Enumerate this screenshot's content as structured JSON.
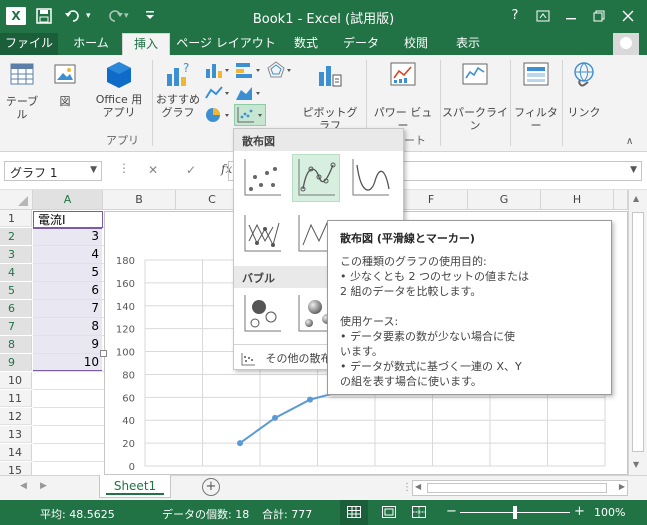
{
  "titlebar": {
    "app_icon": "X",
    "title": "Book1 - Excel (試用版)",
    "help": "?",
    "colors": {
      "bar": "#217346"
    }
  },
  "tabs": [
    {
      "label": "ファイル"
    },
    {
      "label": "ホーム"
    },
    {
      "label": "挿入"
    },
    {
      "label": "ページ レイアウト"
    },
    {
      "label": "数式"
    },
    {
      "label": "データ"
    },
    {
      "label": "校閲"
    },
    {
      "label": "表示"
    }
  ],
  "ribbon": {
    "table": "テーブル",
    "picture": "図",
    "office_apps": [
      "Office 用",
      "アプリ"
    ],
    "recommended_charts": [
      "おすすめ",
      "グラフ"
    ],
    "pivot_chart": "ピボットグラフ",
    "power_view": "パワー ビュー",
    "sparkline": "スパークライン",
    "filter": "フィルター",
    "link": "リンク",
    "group_apps": "アプリ",
    "group_chart_tail": "ート"
  },
  "formula_bar": {
    "name_box": "グラフ 1",
    "cancel": "✕",
    "enter": "✓",
    "fx": "fx"
  },
  "grid": {
    "columns": [
      "A",
      "B",
      "C",
      "D",
      "E",
      "F",
      "G",
      "H"
    ],
    "rows": [
      "1",
      "2",
      "3",
      "4",
      "5",
      "6",
      "7",
      "8",
      "9",
      "10",
      "11",
      "12",
      "13",
      "14",
      "15"
    ],
    "cells": {
      "A1": "電流I",
      "A2": "3",
      "A3": "4",
      "A4": "5",
      "A5": "6",
      "A6": "7",
      "A7": "8",
      "A8": "9",
      "A9": "10"
    }
  },
  "chart": {
    "chart_data": {
      "type": "scatter",
      "y_ticks": [
        "180",
        "160",
        "140",
        "120",
        "100",
        "80",
        "60",
        "40",
        "20",
        "0"
      ],
      "ylim": [
        0,
        180
      ],
      "series": [
        {
          "values_xy": [
            [
              3,
              20
            ],
            [
              4,
              42
            ],
            [
              5,
              58
            ],
            [
              6,
              66
            ]
          ]
        }
      ],
      "line_color": "#5b9bd5",
      "grid": true
    }
  },
  "gallery": {
    "scatter_header": "散布図",
    "bubble_header": "バブル",
    "more_label": "その他の散布"
  },
  "tooltip": {
    "title": "散布図 (平滑線とマーカー)",
    "lines": [
      "この種類のグラフの使用目的:",
      "• 少なくとも 2 つのセットの値または",
      "2 組のデータを比較します。",
      "",
      "使用ケース:",
      "• データ要素の数が少ない場合に使",
      "います。",
      "• データが数式に基づく一連の X、Y",
      "の組を表す場合に使います。"
    ]
  },
  "sheets": {
    "active": "Sheet1",
    "add": "+"
  },
  "status": {
    "average": "平均: 48.5625",
    "count": "データの個数: 18",
    "sum": "合計: 777",
    "zoom": "100%",
    "minus": "−",
    "plus": "+"
  }
}
